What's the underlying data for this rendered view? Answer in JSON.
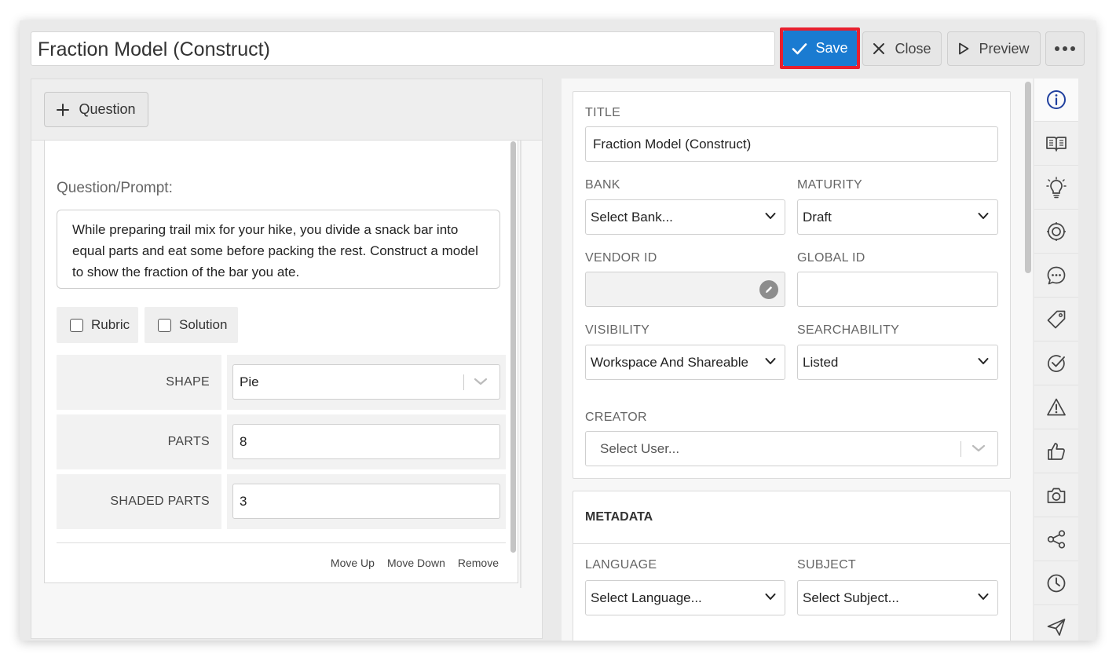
{
  "header": {
    "title_value": "Fraction Model (Construct)",
    "save_label": "Save",
    "close_label": "Close",
    "preview_label": "Preview"
  },
  "left": {
    "add_question_label": "Question",
    "prompt_label": "Question/Prompt:",
    "prompt_text": "While preparing trail mix for your hike, you divide a snack bar into equal parts and eat some before packing the rest. Construct a model to show the fraction of the bar you ate.",
    "rubric_label": "Rubric",
    "solution_label": "Solution",
    "shape_label": "SHAPE",
    "shape_value": "Pie",
    "parts_label": "PARTS",
    "parts_value": "8",
    "shaded_label": "SHADED PARTS",
    "shaded_value": "3",
    "move_up_label": "Move Up",
    "move_down_label": "Move Down",
    "remove_label": "Remove"
  },
  "right": {
    "title_label": "TITLE",
    "title_value": "Fraction Model (Construct)",
    "bank_label": "BANK",
    "bank_value": "Select Bank...",
    "maturity_label": "MATURITY",
    "maturity_value": "Draft",
    "vendor_id_label": "VENDOR ID",
    "vendor_id_value": "",
    "global_id_label": "GLOBAL ID",
    "global_id_value": "",
    "visibility_label": "VISIBILITY",
    "visibility_value": "Workspace And Shareable",
    "searchability_label": "SEARCHABILITY",
    "searchability_value": "Listed",
    "creator_label": "CREATOR",
    "creator_placeholder": "Select User...",
    "metadata_title": "METADATA",
    "language_label": "LANGUAGE",
    "language_value": "Select Language...",
    "subject_label": "SUBJECT",
    "subject_value": "Select Subject..."
  },
  "rail": {
    "icons": [
      "info-icon",
      "book-icon",
      "lightbulb-icon",
      "target-icon",
      "comment-icon",
      "tag-icon",
      "check-circle-icon",
      "warning-icon",
      "thumbs-up-icon",
      "camera-icon",
      "share-icon",
      "clock-icon",
      "send-icon"
    ],
    "active": "info-icon"
  },
  "colors": {
    "save_button": "#1a7bd1",
    "highlight_border": "#e8202e",
    "active_rail_icon": "#1f3f9e"
  }
}
